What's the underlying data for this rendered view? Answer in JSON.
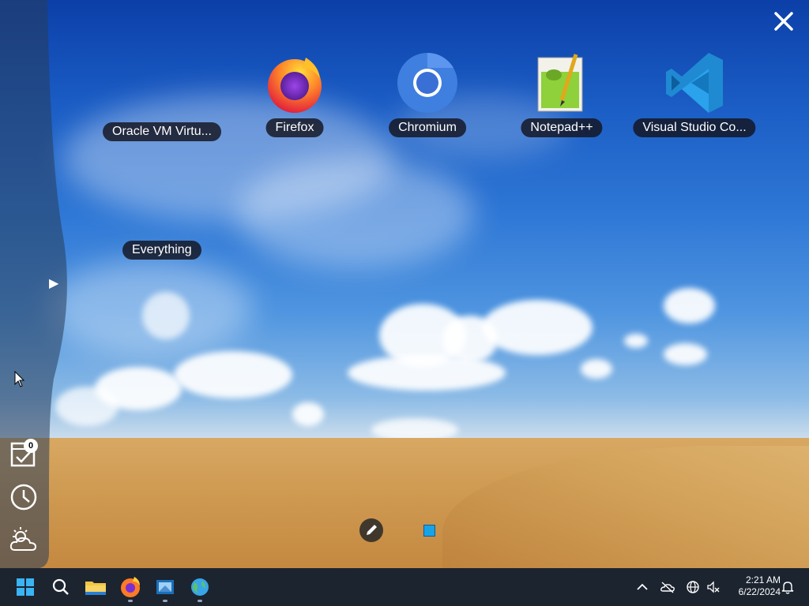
{
  "desktop": {
    "shortcuts": [
      {
        "label": "Oracle VM Virtu...",
        "icon": "virtualbox-icon"
      },
      {
        "label": "Firefox",
        "icon": "firefox-icon"
      },
      {
        "label": "Chromium",
        "icon": "chromium-icon"
      },
      {
        "label": "Notepad++",
        "icon": "notepadpp-icon"
      },
      {
        "label": "Visual Studio Co...",
        "icon": "vscode-icon"
      }
    ],
    "everything_label": "Everything"
  },
  "side_panel": {
    "tasks_badge": "0",
    "icons": [
      "tasks-icon",
      "clock-icon",
      "weather-icon"
    ]
  },
  "taskbar": {
    "apps": [
      "start-icon",
      "search-icon",
      "file-explorer-icon",
      "firefox-icon",
      "virtualbox-icon",
      "browser-globe-icon"
    ],
    "clock": {
      "time": "2:21 AM",
      "date": "6/22/2024"
    }
  },
  "colors": {
    "taskbar": "#1c2430",
    "vscode": "#1f8ad2",
    "chromium": "#3f7fe0",
    "label_bg": "#14141e"
  }
}
